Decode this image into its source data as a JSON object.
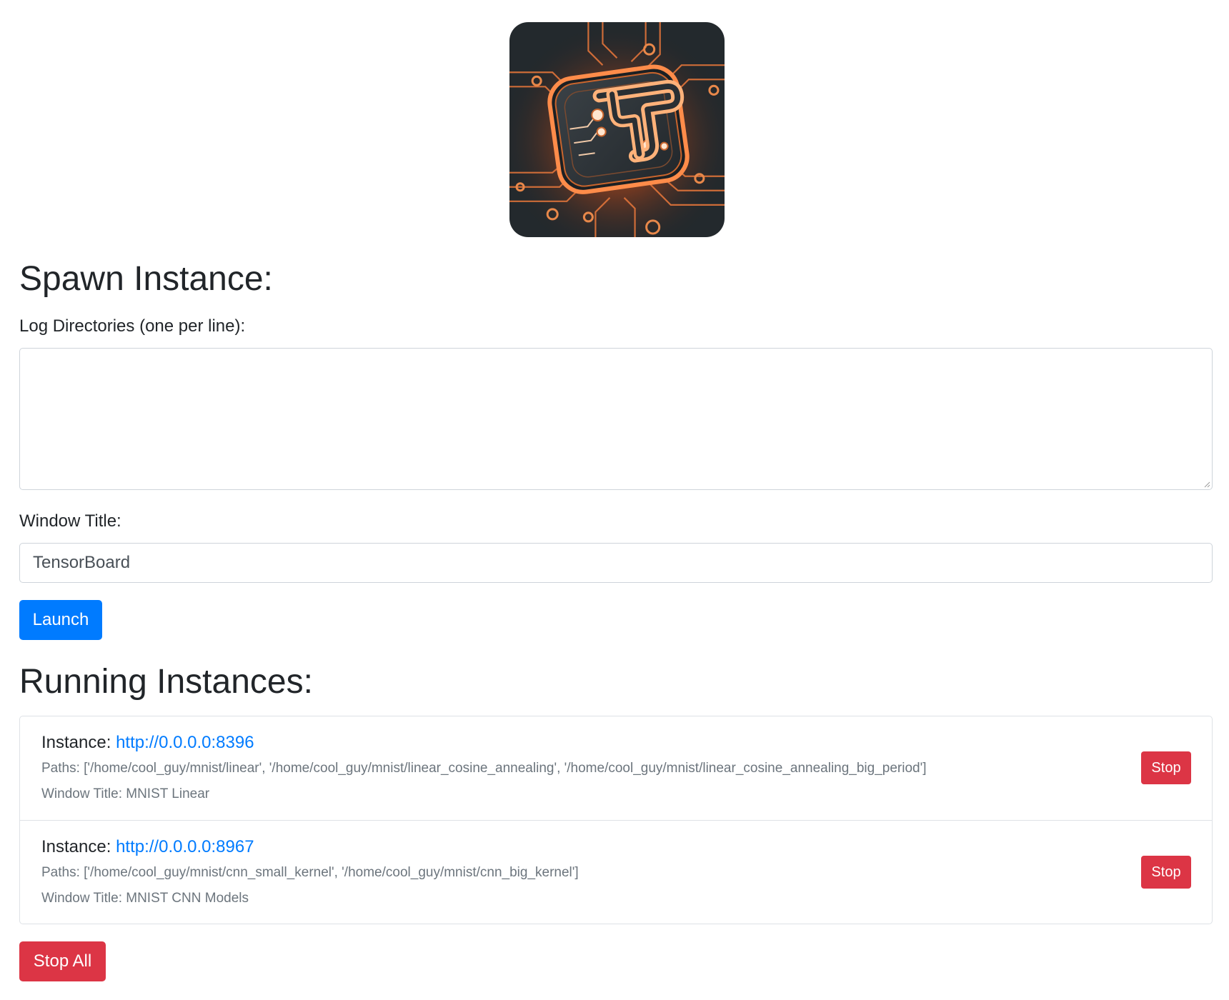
{
  "logo": {
    "icon": "tensorboard-circuit-logo-icon"
  },
  "spawn": {
    "heading": "Spawn Instance:",
    "log_dirs_label": "Log Directories (one per line):",
    "log_dirs_value": "",
    "window_title_label": "Window Title:",
    "window_title_value": "TensorBoard",
    "launch_label": "Launch"
  },
  "running": {
    "heading": "Running Instances:",
    "instances": [
      {
        "prefix": "Instance: ",
        "url": "http://0.0.0.0:8396",
        "paths": "Paths: ['/home/cool_guy/mnist/linear', '/home/cool_guy/mnist/linear_cosine_annealing', '/home/cool_guy/mnist/linear_cosine_annealing_big_period']",
        "window_title": "Window Title: MNIST Linear",
        "stop_label": "Stop"
      },
      {
        "prefix": "Instance: ",
        "url": "http://0.0.0.0:8967",
        "paths": "Paths: ['/home/cool_guy/mnist/cnn_small_kernel', '/home/cool_guy/mnist/cnn_big_kernel']",
        "window_title": "Window Title: MNIST CNN Models",
        "stop_label": "Stop"
      }
    ],
    "stop_all_label": "Stop All"
  },
  "colors": {
    "primary": "#007bff",
    "danger": "#dc3545",
    "muted": "#6c757d",
    "border": "#ced4da",
    "logo_accent": "#f08a4b"
  }
}
